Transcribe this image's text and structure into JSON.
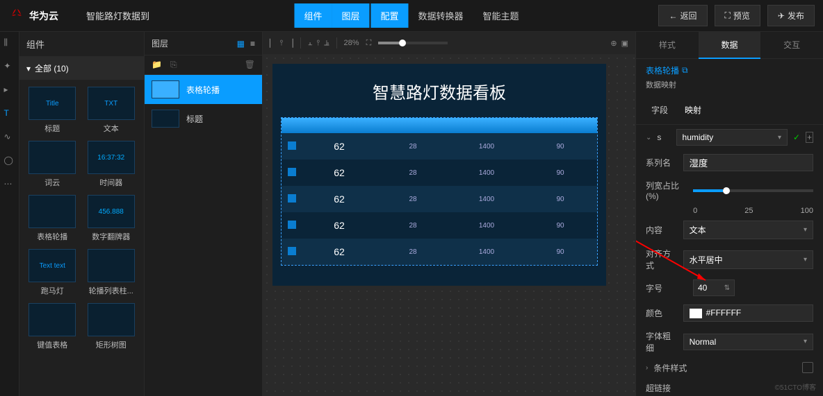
{
  "header": {
    "brand": "华为云",
    "project": "智能路灯数据到",
    "tabs": [
      "组件",
      "图层",
      "配置",
      "数据转换器",
      "智能主题"
    ],
    "actions": {
      "back": "返回",
      "preview": "预览",
      "publish": "发布"
    }
  },
  "components": {
    "title": "组件",
    "all": "全部 (10)",
    "items": [
      {
        "label": "标题",
        "thumb": "Title"
      },
      {
        "label": "文本",
        "thumb": "TXT"
      },
      {
        "label": "词云",
        "thumb": ""
      },
      {
        "label": "时间器",
        "thumb": "16:37:32"
      },
      {
        "label": "表格轮播",
        "thumb": ""
      },
      {
        "label": "数字翻牌器",
        "thumb": "456.888"
      },
      {
        "label": "跑马灯",
        "thumb": "Text text"
      },
      {
        "label": "轮播列表柱...",
        "thumb": ""
      },
      {
        "label": "键值表格",
        "thumb": ""
      },
      {
        "label": "矩形树图",
        "thumb": ""
      }
    ]
  },
  "layers": {
    "title": "图层",
    "items": [
      {
        "label": "表格轮播",
        "selected": true
      },
      {
        "label": "标题",
        "selected": false
      }
    ]
  },
  "canvas": {
    "zoom": "28%",
    "dashboard_title": "智慧路灯数据看板",
    "rows": [
      {
        "c1": "62",
        "c2": "28",
        "c3": "1400",
        "c4": "90"
      },
      {
        "c1": "62",
        "c2": "28",
        "c3": "1400",
        "c4": "90"
      },
      {
        "c1": "62",
        "c2": "28",
        "c3": "1400",
        "c4": "90"
      },
      {
        "c1": "62",
        "c2": "28",
        "c3": "1400",
        "c4": "90"
      },
      {
        "c1": "62",
        "c2": "28",
        "c3": "1400",
        "c4": "90"
      }
    ]
  },
  "right": {
    "tabs": [
      "样式",
      "数据",
      "交互"
    ],
    "widget": "表格轮播",
    "mapping": "数据映射",
    "inner_tabs": [
      "字段",
      "映射"
    ],
    "expand_key": "s",
    "mapping_value": "humidity",
    "series_label": "系列名",
    "series_value": "湿度",
    "width_label": "列宽占比\n(%)",
    "width_scale": [
      "0",
      "25",
      "100"
    ],
    "content_label": "内容",
    "content_value": "文本",
    "align_label": "对齐方式",
    "align_value": "水平居中",
    "font_label": "字号",
    "font_value": "40",
    "color_label": "颜色",
    "color_value": "#FFFFFF",
    "weight_label": "字体粗细",
    "weight_value": "Normal",
    "cond_label": "条件样式",
    "link_label": "超链接"
  },
  "watermark": "©51CTO博客"
}
